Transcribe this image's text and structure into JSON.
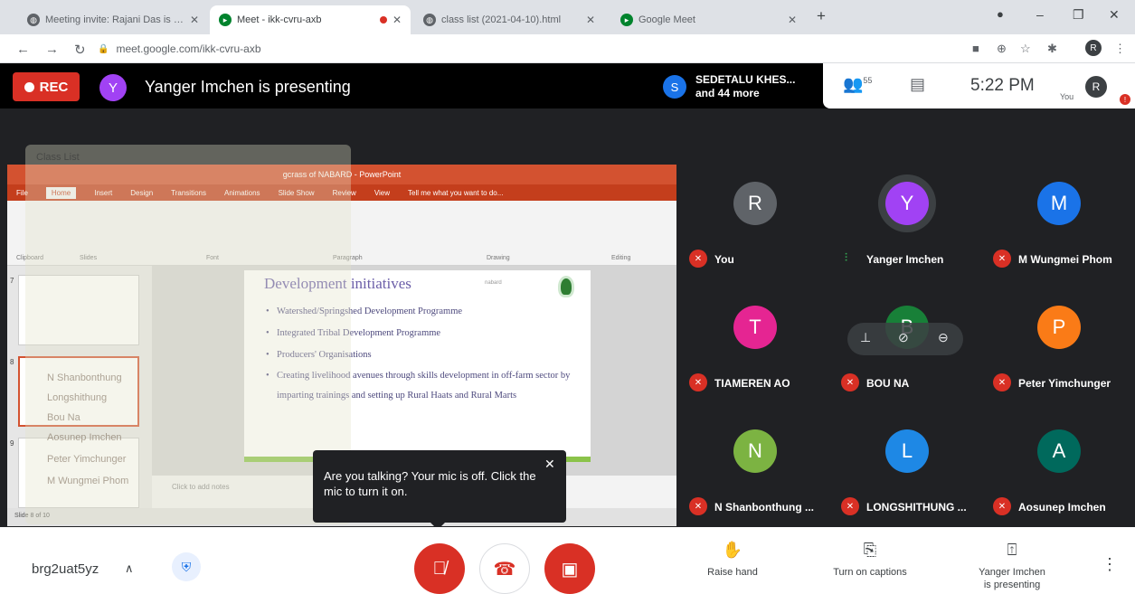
{
  "browser": {
    "tabs": [
      {
        "title": "Meeting invite: Rajani Das is invi",
        "favicon": "globe-icon",
        "active": false
      },
      {
        "title": "Meet - ikk-cvru-axb",
        "favicon": "meet-icon",
        "active": true,
        "recording": true
      },
      {
        "title": "class list (2021-04-10).html",
        "favicon": "globe-icon",
        "active": false
      },
      {
        "title": "Google Meet",
        "favicon": "meet-icon",
        "active": false
      }
    ],
    "new_tab": "+",
    "url": "meet.google.com/ikk-cvru-axb",
    "profile_initial": "R"
  },
  "meet": {
    "rec_label": "REC",
    "presenter_initial": "Y",
    "presenting_text": "Yanger Imchen is presenting",
    "people_chip": {
      "initial": "S",
      "line1": "SEDETALU KHES...",
      "line2": "and 44 more"
    },
    "people_count": "55",
    "time": "5:22 PM",
    "you_label": "You",
    "profile_initial": "R",
    "alert_badge": "!"
  },
  "presentation": {
    "window_title": "gcrass of NABARD - PowerPoint",
    "ribbon_tabs": [
      "File",
      "Home",
      "Insert",
      "Design",
      "Transitions",
      "Animations",
      "Slide Show",
      "Review",
      "View",
      "Tell me what you want to do..."
    ],
    "ribbon_groups": [
      "Clipboard",
      "Slides",
      "Font",
      "Paragraph",
      "Drawing",
      "Editing"
    ],
    "slide_numbers": [
      "7",
      "8",
      "9"
    ],
    "slide": {
      "title": "Development initiatives",
      "tag": "nabard",
      "bullets": [
        "Watershed/Springshed Development Programme",
        "Integrated Tribal Development Programme",
        "Producers' Organisations",
        "Creating livelihood avenues through skills development in off-farm sector by imparting trainings and setting up Rural Haats and Rural Marts"
      ]
    },
    "notes_placeholder": "Click to add notes",
    "status_text": "Slide 8 of 10"
  },
  "overlay_list": {
    "title": "Class List",
    "items": [
      "N Shanbonthung",
      "Longshithung",
      "Bou Na",
      "Aosunep Imchen",
      "Peter Yimchunger",
      "M Wungmei Phom"
    ]
  },
  "toast": {
    "message": "Are you talking? Your mic is off. Click the mic to turn it on."
  },
  "participants": [
    {
      "initial": "R",
      "name": "You",
      "color": "#5f6368",
      "muted": true
    },
    {
      "initial": "Y",
      "name": "Yanger Imchen",
      "color": "#a142f4",
      "muted": false
    },
    {
      "initial": "M",
      "name": "M Wungmei Phom",
      "color": "#1a73e8",
      "muted": true
    },
    {
      "initial": "T",
      "name": "TIAMEREN AO",
      "color": "#e52592",
      "muted": true
    },
    {
      "initial": "B",
      "name": "BOU NA",
      "color": "#188038",
      "muted": true
    },
    {
      "initial": "P",
      "name": "Peter Yimchunger",
      "color": "#fa7b17",
      "muted": true
    },
    {
      "initial": "N",
      "name": "N Shanbonthung ...",
      "color": "#7cb342",
      "muted": true
    },
    {
      "initial": "L",
      "name": "LONGSHITHUNG ...",
      "color": "#1e88e5",
      "muted": true
    },
    {
      "initial": "A",
      "name": "Aosunep Imchen",
      "color": "#00695c",
      "muted": true
    }
  ],
  "bottom": {
    "meeting_code": "brg2uat5yz",
    "raise_hand": "Raise hand",
    "captions": "Turn on captions",
    "presenting_line1": "Yanger Imchen",
    "presenting_line2": "is presenting"
  },
  "colors": {
    "accent_red": "#d93025",
    "meet_bg": "#202124"
  }
}
